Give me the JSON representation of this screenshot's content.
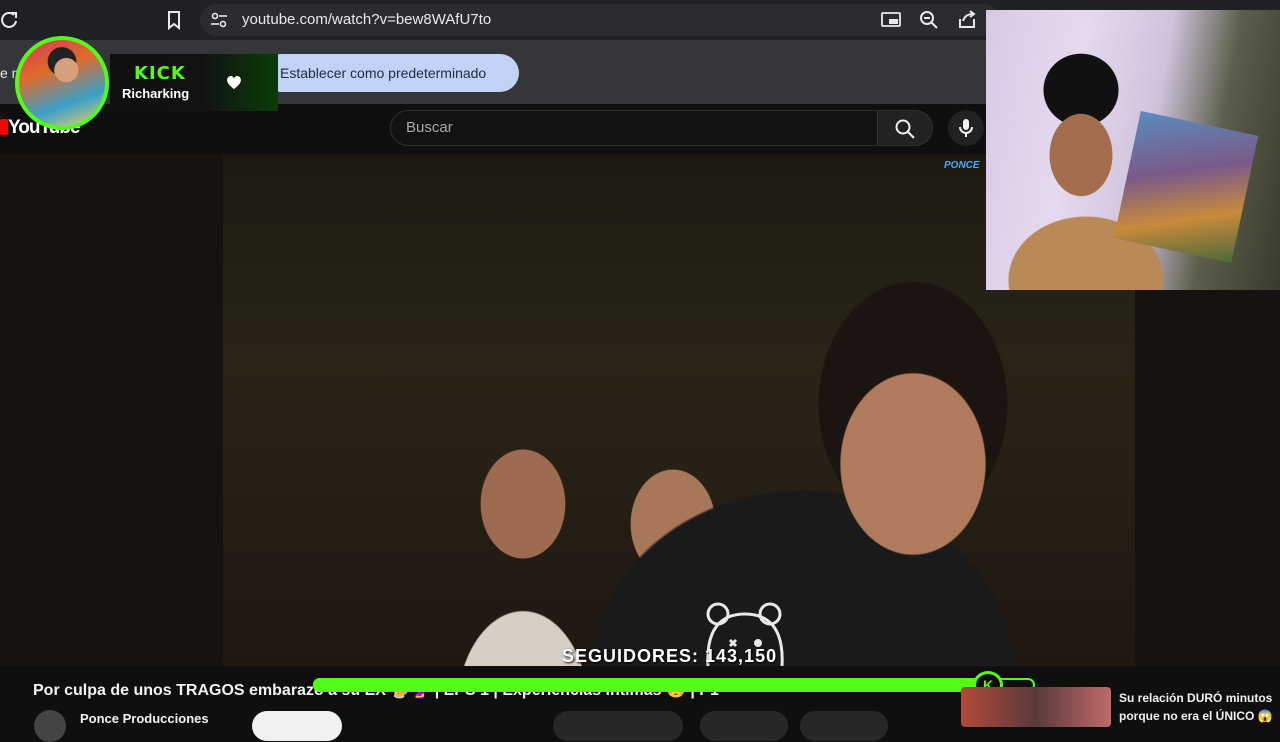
{
  "browser": {
    "url": "youtube.com/watch?v=bew8WAfU7to"
  },
  "infobar": {
    "text": "e n",
    "button_label": "Establecer como predeterminado"
  },
  "kick": {
    "wordmark": "KICK",
    "username": "Richarking",
    "brand_color": "#53fc18"
  },
  "youtube": {
    "logo_text": "YouTube",
    "search_placeholder": "Buscar"
  },
  "video": {
    "channel_watermark": "PONCE",
    "followers_label": "SEGUIDORES: 143,150",
    "title": "Por culpa de unos TRAGOS embarazó a su EX 🍺🤰 | EPS 1 | Experiencias Íntimas 😳 | P1",
    "channel_name": "Ponce Producciones",
    "progress_fraction": 0.93
  },
  "recommended": {
    "title": "Su relación DURÓ minutos porque no era el ÚNICO 😱"
  },
  "icons": {
    "reload": "reload-icon",
    "bookmark": "bookmark-icon",
    "site_info": "site-info-icon",
    "cast": "cast-icon",
    "zoom": "zoom-icon",
    "share": "share-icon",
    "heart": "heart-icon",
    "search": "search-icon",
    "mic": "mic-icon"
  }
}
